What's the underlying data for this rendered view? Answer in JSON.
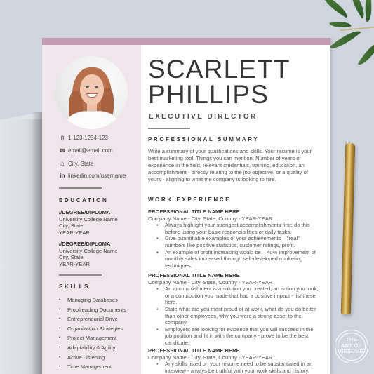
{
  "resume": {
    "name_first": "SCARLETT",
    "name_last": "PHILLIPS",
    "role": "EXECUTIVE DIRECTOR",
    "contact": [
      {
        "icon": "phone-icon",
        "glyph": "▯",
        "text": "1-123-1234-123"
      },
      {
        "icon": "email-icon",
        "glyph": "✉",
        "text": "email@email.com"
      },
      {
        "icon": "home-icon",
        "glyph": "⌂",
        "text": "City, State"
      },
      {
        "icon": "linkedin-icon",
        "glyph": "in",
        "text": "linkedin.com/username"
      }
    ],
    "education": {
      "title": "EDUCATION",
      "entries": [
        {
          "degree": "//DEGREE/DIPLOMA",
          "school": "University College Name",
          "location": "City, State",
          "years": "YEAR-YEAR"
        },
        {
          "degree": "//DEGREE/DIPLOMA",
          "school": "University College Name",
          "location": "City, State",
          "years": "YEAR-YEAR"
        }
      ]
    },
    "skills": {
      "title": "SKILLS",
      "bullet": "•",
      "items": [
        "Managing Databases",
        "Proofreading Documents",
        "Entrepreneurial Drive",
        "Organization Strategies",
        "Project Management",
        "Adaptability & Agility",
        "Active Listening",
        "Time Management"
      ]
    },
    "summary": {
      "title": "PROFESSIONAL SUMMARY",
      "text": "Write a summary of your qualifications and skills. Your resume is your best marketing tool. Things you can mention: Number of years of experience in the field, relevant credentials, training, education, an accomplishment - directly relating to the job objective, or a quality of yours - aligning to what the company is looking to hire."
    },
    "experience": {
      "title": "WORK EXPERIENCE",
      "bullet": "•",
      "jobs": [
        {
          "title": "PROFESSIONAL TITLE NAME HERE",
          "company": "Company Name - City, State, Country - YEAR-YEAR",
          "bullets": [
            "Always highlight your strongest accomplishments first; do this before listing your basic responsibilities or daily tasks.",
            "Give quantifiable examples of your achievements – \"real\" numbers like positive statistics, customer ratings, profit.",
            "An example of profit increasing would be – 40% improvement of monthly sales increased through self-developed marketing techniques."
          ]
        },
        {
          "title": "PROFESSIONAL TITLE NAME HERE",
          "company": "Company Name - City, State, Country - YEAR-YEAR",
          "bullets": [
            "An accomplishment is a solution you created, an action you took, or a contribution you made that had a positive impact - list these here.",
            "State what are you most proud of at work, what do you do better than other employees, why you were a strong asset to the company.",
            "Employers are looking for evidence that you will succeed in the job position and fit in with the company - prove to be the best candidate."
          ]
        },
        {
          "title": "PROFESSIONAL TITLE NAME HERE",
          "company": "Company Name - City, State, Country - YEAR-YEAR",
          "bullets": [
            "Any skills listed on your resume need to be substantiated in an interview - always be truthful with your work skills and history."
          ]
        }
      ]
    }
  },
  "badge": {
    "line1": "THE",
    "line2": "ART OF",
    "line3": "RESUME",
    "glyph": "♢"
  },
  "colors": {
    "background": "#cfd5df",
    "accent_bar": "#c49cb3",
    "sidebar": "#f0e5ea",
    "text": "#363636"
  }
}
